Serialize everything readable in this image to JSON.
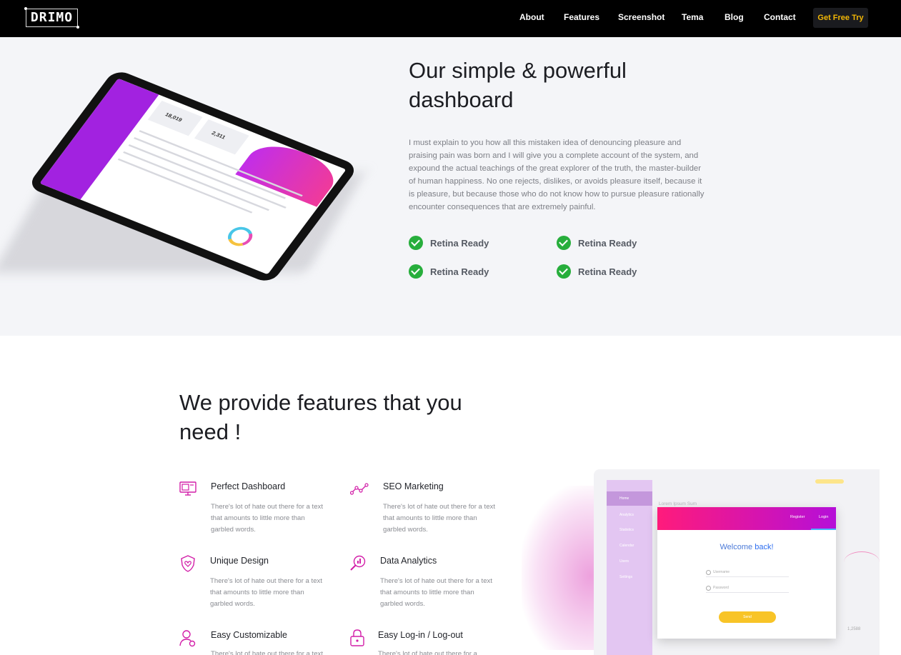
{
  "nav": {
    "logo": "DRIMO",
    "items": [
      "About",
      "Features",
      "Screenshot",
      "Tema",
      "Blog",
      "Contact"
    ],
    "cta": "Get Free Try"
  },
  "hero": {
    "title": "Our simple & powerful dashboard",
    "body": "I must explain to you how all this mistaken idea of denouncing pleasure and praising pain was born and I will give you a complete account of the system, and expound the actual teachings of the great explorer of the truth, the master-builder of human happiness. No one rejects, dislikes, or avoids pleasure itself, because it is pleasure, but because those who do not know how to pursue pleasure rationally encounter consequences that are extremely painful.",
    "features": [
      "Retina Ready",
      "Retina Ready",
      "Retina Ready",
      "Retina Ready"
    ]
  },
  "tablet_screen": {
    "stat_1": "18,019",
    "stat_2": "2,311"
  },
  "features": {
    "title": "We provide features that you need !",
    "items": [
      {
        "title": "Perfect Dashboard",
        "desc": "There's lot of hate out there for a text that amounts to little more than garbled words.",
        "icon": "monitor-dashboard-icon"
      },
      {
        "title": "SEO Marketing",
        "desc": "There's lot of hate out there for a text that amounts to little more than garbled words.",
        "icon": "line-graph-icon"
      },
      {
        "title": "Unique Design",
        "desc": "There's lot of hate out there for a text that amounts to little more than garbled words.",
        "icon": "shield-heart-icon"
      },
      {
        "title": "Data Analytics",
        "desc": "There's lot of hate out there for a text that amounts to little more than garbled words.",
        "icon": "magnifier-chart-icon"
      },
      {
        "title": "Easy Customizable",
        "desc": "There's lot of hate out there for a text",
        "icon": "user-gear-icon"
      },
      {
        "title": "Easy Log-in / Log-out",
        "desc": "There's lot of hate out there for a",
        "icon": "padlock-icon"
      }
    ]
  },
  "laptop": {
    "sidebar": [
      "Home",
      "Analytics",
      "Statistics",
      "Calendar",
      "Users",
      "Settings"
    ],
    "page_title": "Lorem Ipsum Sum",
    "tab_register": "Register",
    "tab_login": "Login",
    "welcome": "Welcome",
    "welcome_emph": "back!",
    "username": "Username",
    "password": "Password",
    "send": "Send",
    "number": "1,2588"
  },
  "colors": {
    "accent_yellow": "#f2b705",
    "brand_purple": "#a222e0",
    "check_green": "#27ae3c",
    "icon_magenta": "#d21ea8"
  }
}
